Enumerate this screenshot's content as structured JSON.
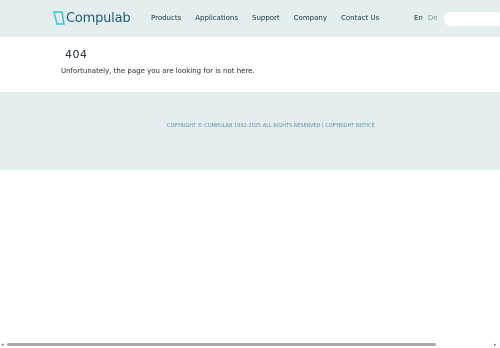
{
  "header": {
    "logo_text": "Compulab",
    "nav": [
      "Products",
      "Applications",
      "Support",
      "Company",
      "Contact Us"
    ],
    "lang": {
      "en": "En",
      "de": "De"
    },
    "search_placeholder": ""
  },
  "main": {
    "code": "404",
    "message": "Unfortunately, the page you are looking for is not here."
  },
  "footer": {
    "text": "COPYRIGHT © COMPULAB 1992-2025 ALL RIGHTS RESERVED | COPYRIGHT NOTICE"
  },
  "scrollbar": {
    "left_arrow": "◂",
    "right_arrow": "▸"
  },
  "colors": {
    "header_bg": "#e5eeee",
    "brand": "#1d5b74",
    "accent_cyan": "#35c6d6",
    "footer_text": "#5f8ea3"
  }
}
